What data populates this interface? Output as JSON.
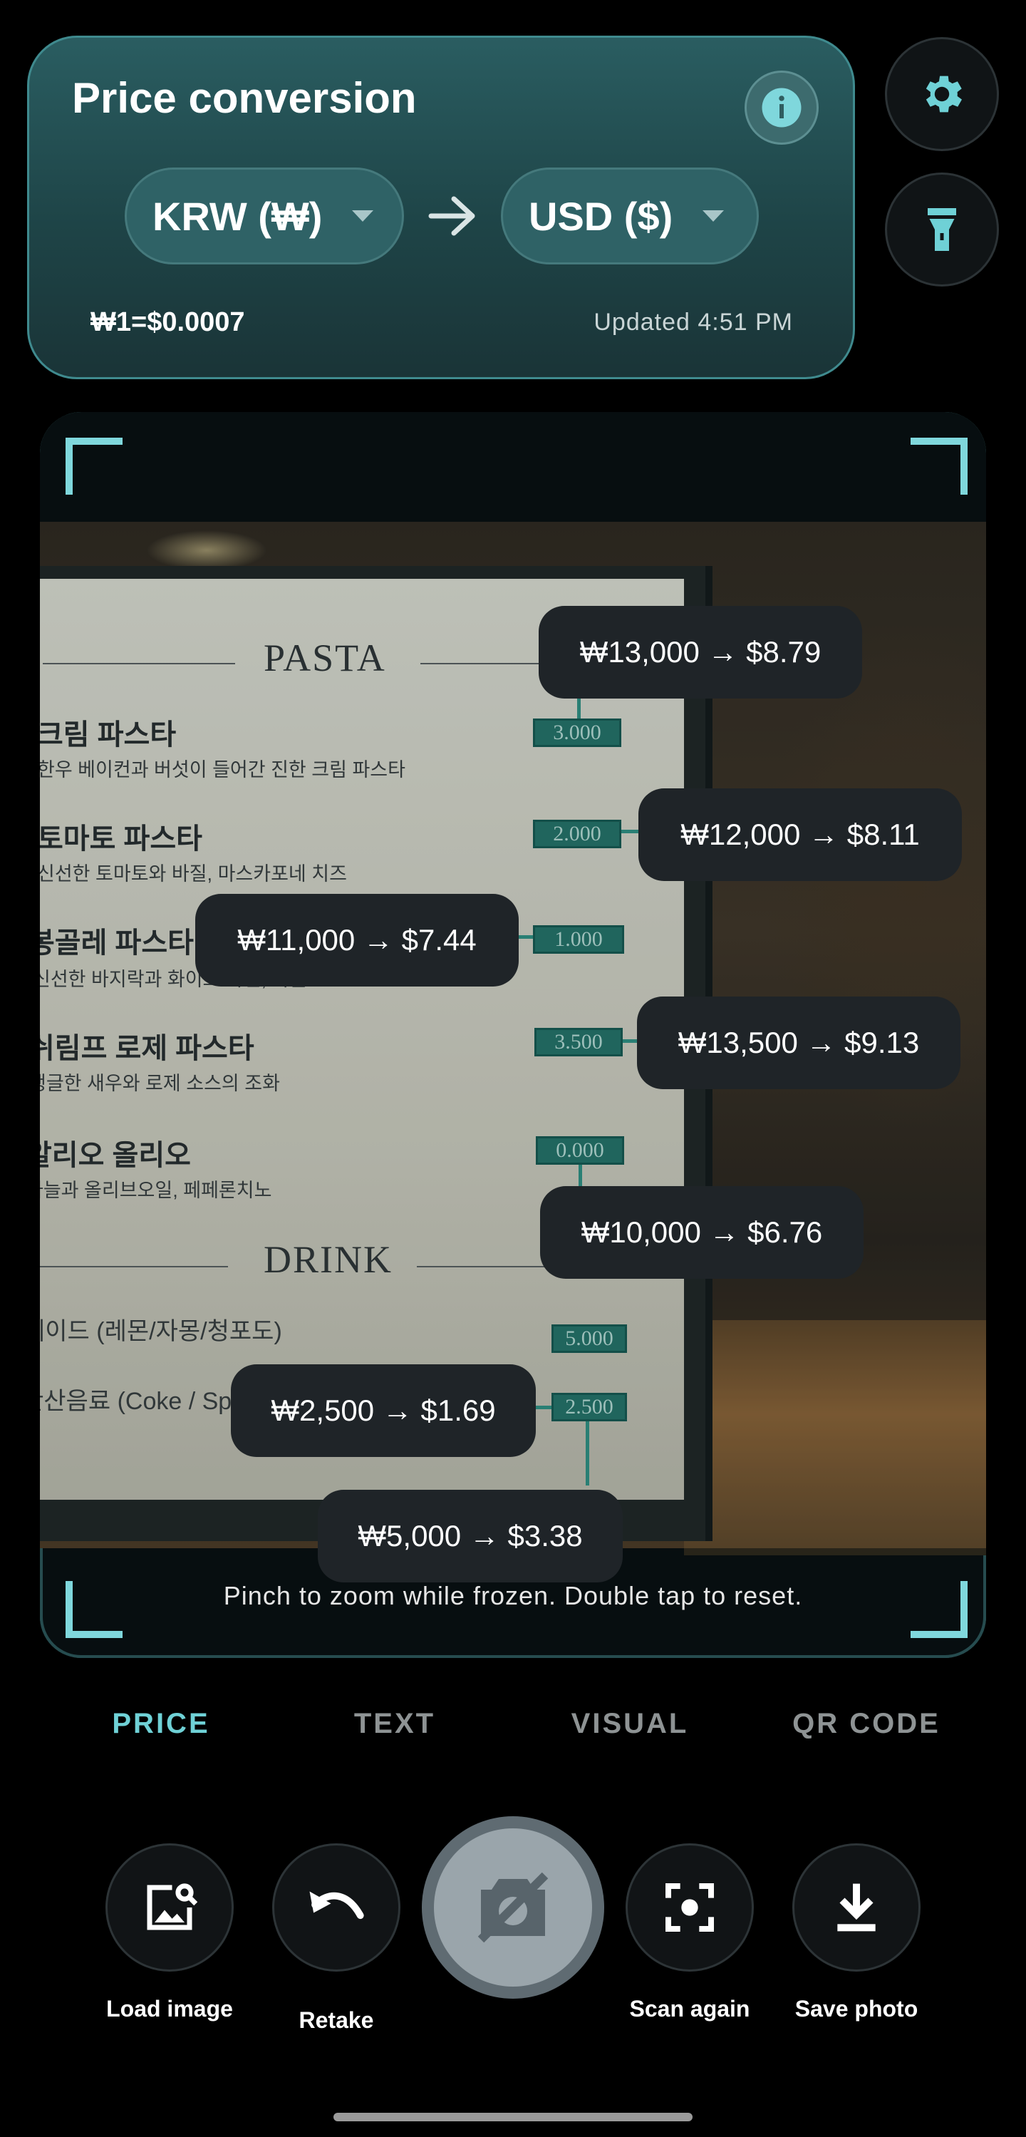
{
  "header": {
    "title": "Price conversion",
    "from_currency": "KRW (₩)",
    "to_currency": "USD ($)",
    "rate": "₩1=$0.0007",
    "updated": "Updated 4:51 PM"
  },
  "menu": {
    "section_pasta": "PASTA",
    "section_drink": "DRINK",
    "items": [
      {
        "name": "크림 파스타",
        "desc": "한우 베이컨과 버섯이 들어간 진한 크림 파스타",
        "price": "3.000"
      },
      {
        "name": "토마토 파스타",
        "desc": "신선한 토마토와 바질, 마스카포네 치즈",
        "price": "2.000"
      },
      {
        "name": "봉골레 파스타",
        "desc": "신선한 바지락과 화이트 와인, 마늘",
        "price": "1.000"
      },
      {
        "name": "쉬림프 로제 파스타",
        "desc": "탱글한 새우와 로제 소스의 조화",
        "price": "3.500"
      },
      {
        "name": "알리오 올리오",
        "desc": "마늘과 올리브오일, 페페론치노",
        "price": "0.000"
      }
    ],
    "drinks": [
      {
        "name": "에이드 (레몬/자몽/청포도)",
        "price": "5.000"
      },
      {
        "name": "탄산음료 (Coke / Sprite)",
        "price": "2.500"
      }
    ]
  },
  "conversions": [
    "₩13,000 → $8.79",
    "₩12,000 → $8.11",
    "₩11,000 → $7.44",
    "₩13,500 → $9.13",
    "₩10,000 → $6.76",
    "₩2,500 → $1.69",
    "₩5,000 → $3.38"
  ],
  "hint": "Pinch to zoom while frozen. Double tap to reset.",
  "tabs": [
    "PRICE",
    "TEXT",
    "VISUAL",
    "QR CODE"
  ],
  "active_tab": "PRICE",
  "controls": {
    "load": "Load image",
    "retake": "Retake",
    "scan": "Scan again",
    "save": "Save photo"
  },
  "colors": {
    "accent": "#6fd1d6",
    "card": "#1e4447",
    "chip": "#1f2428"
  }
}
